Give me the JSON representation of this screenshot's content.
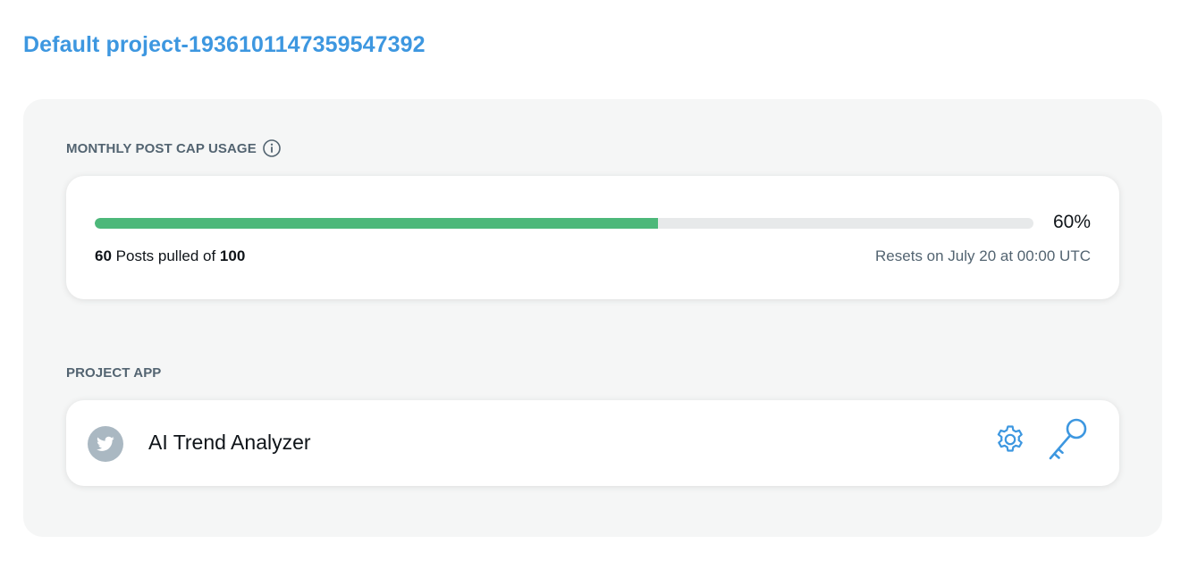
{
  "project": {
    "title": "Default project-1936101147359547392"
  },
  "usage": {
    "section_label": "MONTHLY POST CAP USAGE",
    "info_icon": "info-icon",
    "percent_label": "60%",
    "progress_fraction": 0.6,
    "pulled_count": "60",
    "pulled_text": "Posts pulled of",
    "cap_count": "100",
    "reset_text": "Resets on July 20 at 00:00 UTC",
    "bar_color": "#4db87a",
    "track_color": "#e7e9ea"
  },
  "project_app": {
    "section_label": "PROJECT APP",
    "app_name": "AI Trend Analyzer",
    "avatar_icon": "twitter-bird-icon",
    "settings_icon": "gear-icon",
    "keys_icon": "key-icon",
    "accent_color": "#3d97e0"
  }
}
